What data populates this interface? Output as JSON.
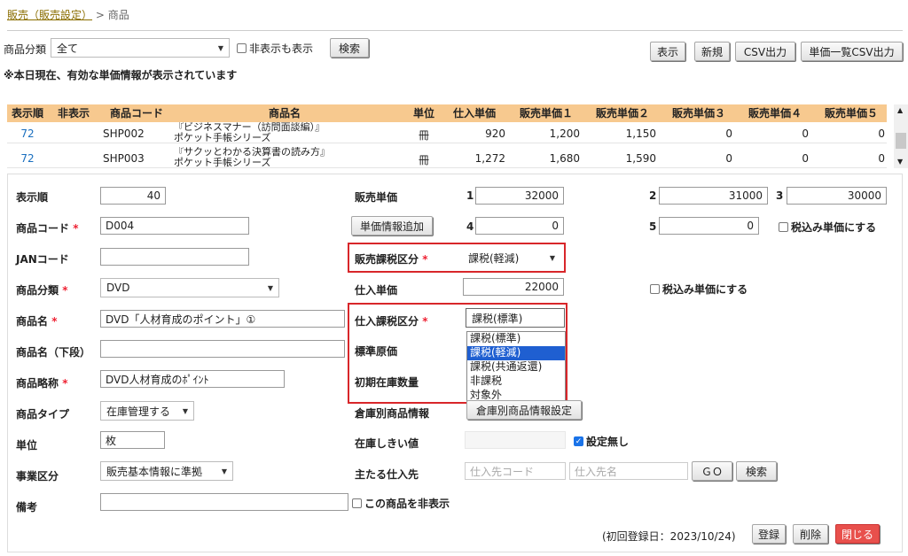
{
  "breadcrumb": {
    "parent": "販売（販売設定）",
    "separator": ">",
    "current": "商品"
  },
  "filter": {
    "category_label": "商品分類",
    "category_value": "全て",
    "show_hidden_label": "非表示も表示",
    "search_label": "検索",
    "notice": "※本日現在、有効な単価情報が表示されています"
  },
  "toolbar": {
    "show": "表示",
    "new": "新規",
    "csv": "CSV出力",
    "price_csv": "単価一覧CSV出力"
  },
  "grid": {
    "headers": [
      "表示順",
      "非表示",
      "商品コード",
      "商品名",
      "単位",
      "仕入単価",
      "販売単価１",
      "販売単価２",
      "販売単価３",
      "販売単価４",
      "販売単価５"
    ],
    "rows": [
      {
        "order": "72",
        "hidden": "",
        "code": "SHP002",
        "name1": "『ビジネスマナー（訪問面談編）』",
        "name2": "ポケット手帳シリーズ",
        "unit": "冊",
        "cost": "920",
        "p1": "1,200",
        "p2": "1,150",
        "p3": "0",
        "p4": "0",
        "p5": "0"
      },
      {
        "order": "72",
        "hidden": "",
        "code": "SHP003",
        "name1": "『サクッとわかる決算書の読み方』",
        "name2": "ポケット手帳シリーズ",
        "unit": "冊",
        "cost": "1,272",
        "p1": "1,680",
        "p2": "1,590",
        "p3": "0",
        "p4": "0",
        "p5": "0"
      }
    ]
  },
  "form": {
    "order_label": "表示順",
    "order_value": "40",
    "code_label": "商品コード",
    "code_value": "D004",
    "jan_label": "JANコード",
    "jan_value": "",
    "cat_label": "商品分類",
    "cat_value": "DVD",
    "name_label": "商品名",
    "name_value": "DVD「人材育成のポイント」①",
    "name2_label": "商品名（下段）",
    "name2_value": "",
    "short_label": "商品略称",
    "short_value": "DVD人材育成のﾎﾟｲﾝﾄ",
    "type_label": "商品タイプ",
    "type_value": "在庫管理する",
    "unit_label": "単位",
    "unit_value": "枚",
    "biz_label": "事業区分",
    "biz_value": "販売基本情報に準拠",
    "note_label": "備考",
    "note_value": "",
    "hide_product_label": "この商品を非表示",
    "required_mark": "*",
    "sale_price_label": "販売単価",
    "prices": [
      {
        "n": "1",
        "v": "32000"
      },
      {
        "n": "2",
        "v": "31000"
      },
      {
        "n": "3",
        "v": "30000"
      },
      {
        "n": "4",
        "v": "0"
      },
      {
        "n": "5",
        "v": "0"
      }
    ],
    "add_price_btn": "単価情報追加",
    "tax_incl_label": "税込み単価にする",
    "sale_tax_label": "販売課税区分",
    "sale_tax_value": "課税(軽減)",
    "cost_label": "仕入単価",
    "cost_value": "22000",
    "cost_tax_incl_label": "税込み単価にする",
    "purchase_tax_label": "仕入課税区分",
    "purchase_tax_value": "課税(標準)",
    "tax_options": [
      "課税(標準)",
      "課税(軽減)",
      "課税(共通返還)",
      "非課税",
      "対象外"
    ],
    "std_cost_label": "標準原価",
    "init_stock_label": "初期在庫数量",
    "warehouse_label": "倉庫別商品情報",
    "warehouse_btn": "倉庫別商品情報設定",
    "threshold_label": "在庫しきい値",
    "no_setting_label": "設定無し",
    "supplier_label": "主たる仕入先",
    "supplier_code_ph": "仕入先コード",
    "supplier_name_ph": "仕入先名",
    "go_btn": "ＧＯ",
    "search_btn": "検索",
    "first_reg": "(初回登録日：2023/10/24)",
    "register_btn": "登録",
    "delete_btn": "削除",
    "close_btn": "閉じる"
  }
}
